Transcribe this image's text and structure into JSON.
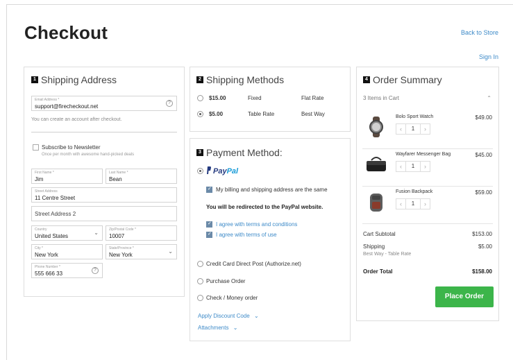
{
  "header": {
    "title": "Checkout",
    "back_link": "Back to Store",
    "signin_link": "Sign In"
  },
  "address": {
    "step": "1",
    "title": "Shipping Address",
    "email_label": "Email Address *",
    "email_value": "support@firecheckout.net",
    "account_hint": "You can create an account after checkout.",
    "newsletter_label": "Subscribe to Newsletter",
    "newsletter_sub": "Once per month with awesome hand-picked deals",
    "first_name_label": "First Name *",
    "first_name": "Jim",
    "last_name_label": "Last Name *",
    "last_name": "Bean",
    "street_label": "Street Address",
    "street": "11 Centre Street",
    "street2_placeholder": "Street Address 2",
    "country_label": "Country",
    "country": "United States",
    "zip_label": "Zip/Postal Code *",
    "zip": "10007",
    "city_label": "City *",
    "city": "New York",
    "state_label": "State/Province *",
    "state": "New York",
    "phone_label": "Phone Number *",
    "phone": "555 666 33"
  },
  "shipping": {
    "step": "2",
    "title": "Shipping Methods",
    "methods": [
      {
        "price": "$15.00",
        "name": "Fixed",
        "carrier": "Flat Rate",
        "selected": false
      },
      {
        "price": "$5.00",
        "name": "Table Rate",
        "carrier": "Best Way",
        "selected": true
      }
    ]
  },
  "payment": {
    "step": "3",
    "title": "Payment Method:",
    "paypal_a": "Pay",
    "paypal_b": "Pal",
    "same_address": "My billing and shipping address are the same",
    "redirect_note": "You will be redirected to the PayPal website.",
    "agree_terms": "I agree with terms and conditions",
    "agree_use": "I agree with terms of use",
    "other_methods": [
      "Credit Card Direct Post (Authorize.net)",
      "Purchase Order",
      "Check / Money order"
    ],
    "discount_link": "Apply Discount Code",
    "attachments_link": "Attachments",
    "caret": "⌄"
  },
  "summary": {
    "step": "4",
    "title": "Order Summary",
    "items_count": "3 Items in Cart",
    "caret": "⌃",
    "items": [
      {
        "name": "Bolo Sport Watch",
        "price": "$49.00",
        "qty": "1"
      },
      {
        "name": "Wayfarer Messenger Bag",
        "price": "$45.00",
        "qty": "1"
      },
      {
        "name": "Fusion Backpack",
        "price": "$59.00",
        "qty": "1"
      }
    ],
    "qty_minus": "‹",
    "qty_plus": "›",
    "subtotal_label": "Cart Subtotal",
    "subtotal": "$153.00",
    "shipping_label": "Shipping",
    "shipping_value": "$5.00",
    "shipping_method": "Best Way - Table Rate",
    "total_label": "Order Total",
    "total": "$158.00",
    "place_order": "Place Order"
  },
  "colors": {
    "accent": "#3cb54a",
    "link": "#3d8ac8"
  }
}
